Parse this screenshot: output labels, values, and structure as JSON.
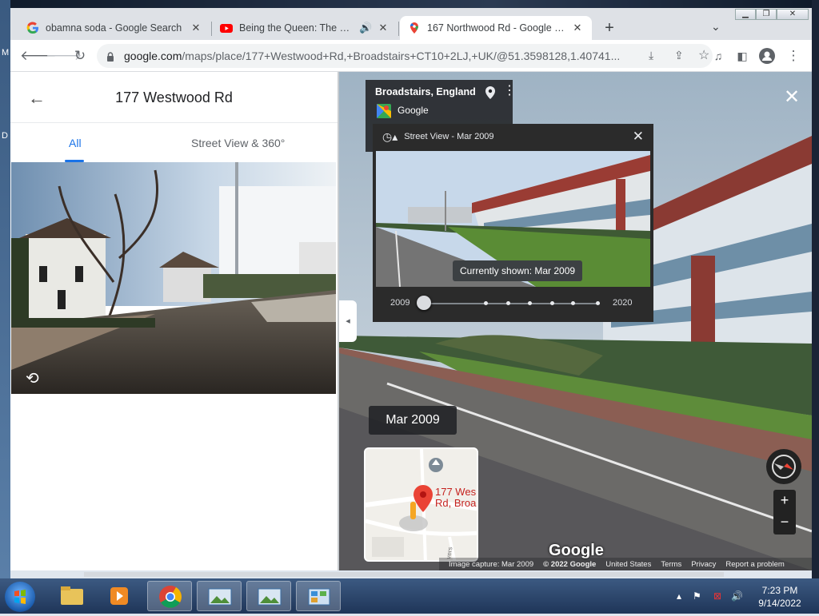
{
  "browser": {
    "tabs": [
      {
        "title": "obamna soda - Google Search",
        "favicon": "google-g-icon"
      },
      {
        "title": "Being the Queen: The Life of",
        "favicon": "youtube-icon",
        "audio": true
      },
      {
        "title": "167 Northwood Rd - Google Ma",
        "favicon": "google-maps-pin-icon",
        "active": true
      }
    ],
    "new_tab_label": "+",
    "url_host": "google.com",
    "url_path": "/maps/place/177+Westwood+Rd,+Broadstairs+CT10+2LJ,+UK/@51.3598128,1.40741..."
  },
  "place_panel": {
    "title": "177 Westwood Rd",
    "tab_all": "All",
    "tab_streetview": "Street View & 360°"
  },
  "streetview": {
    "location_title": "Broadstairs, England",
    "location_provider": "Google",
    "history_title": "Street View - Mar 2009",
    "currently_shown": "Currently shown: Mar 2009",
    "timeline_start": "2009",
    "timeline_end": "2020",
    "timeline_selected_index": 0,
    "timeline_stop_count": 7,
    "date_label": "Mar 2009",
    "minimap_label_line1": "177 Wes",
    "minimap_label_line2": "Rd, Broa",
    "minimap_street": "vers",
    "google_logo": "Google",
    "footer": {
      "capture": "Image capture: Mar 2009",
      "copyright": "© 2022 Google",
      "region": "United States",
      "terms": "Terms",
      "privacy": "Privacy",
      "report": "Report a problem"
    }
  },
  "taskbar": {
    "time": "7:23 PM",
    "date": "9/14/2022",
    "apps": [
      "explorer-icon",
      "media-player-icon",
      "chrome-icon",
      "picture-viewer-icon",
      "picture-viewer-icon",
      "control-panel-icon"
    ]
  },
  "colors": {
    "accent": "#1a73e8",
    "maps_pin": "#ea4335",
    "taskbar": "#1f3558"
  }
}
